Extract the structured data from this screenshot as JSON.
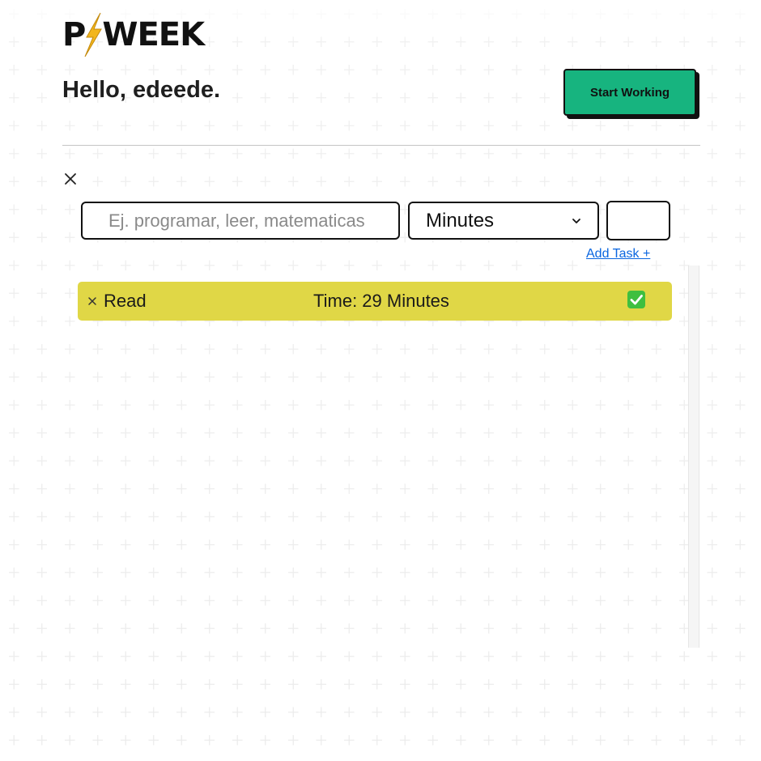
{
  "logo": {
    "prefix": "P",
    "suffix": "WEEK"
  },
  "header": {
    "greeting": "Hello, edeede.",
    "start_button": "Start Working"
  },
  "form": {
    "task_placeholder": "Ej. programar, leer, matematicas",
    "task_value": "",
    "unit_selected": "Minutes",
    "amount_value": "",
    "add_task_label": "Add Task +"
  },
  "tasks": [
    {
      "name": "Read",
      "time_label": "Time: 29 Minutes",
      "done": true
    }
  ],
  "icons": {
    "close": "close-icon",
    "logo_bolt": "lightning-bolt-icon",
    "dropdown": "chevron-down-icon",
    "check": "check-mark-icon"
  },
  "colors": {
    "accent_button": "#17b47f",
    "task_row": "#e0d746",
    "check": "#3fbf3f",
    "link": "#0a66e0",
    "bolt": "#f2b61d"
  }
}
